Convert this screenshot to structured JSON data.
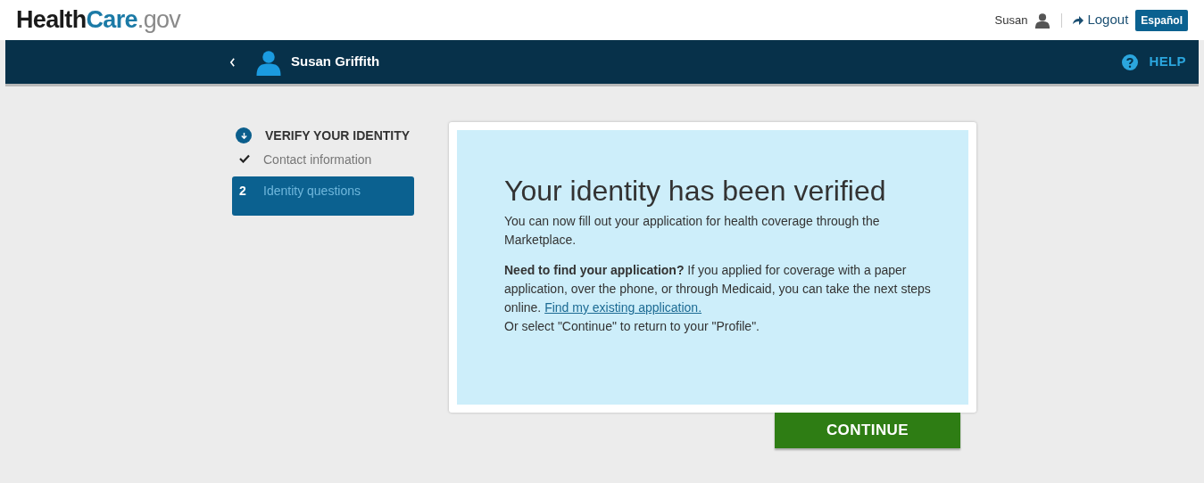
{
  "header": {
    "logo": [
      "Health",
      "Care",
      ".gov"
    ],
    "user": "Susan",
    "logout": "Logout",
    "language": "Español"
  },
  "nav": {
    "name": "Susan Griffith",
    "help": "HELP"
  },
  "steps": [
    {
      "kind": "section",
      "label": "VERIFY YOUR IDENTITY"
    },
    {
      "kind": "done",
      "label": "Contact information",
      "selected": false
    },
    {
      "kind": "numbered",
      "number": "2",
      "label": "Identity questions",
      "selected": true
    }
  ],
  "message": {
    "title": "Your identity has been verified",
    "intro": "You can now fill out your application for health coverage through the Marketplace.",
    "find": "**Need to find your application?** If you applied for coverage with a paper application, over the phone, or through Medicaid, you can take the next steps online.",
    "link": "Find my existing application.",
    "note": "Or select \"Continue\" to return to your \"Profile\"."
  },
  "continue": "CONTINUE"
}
